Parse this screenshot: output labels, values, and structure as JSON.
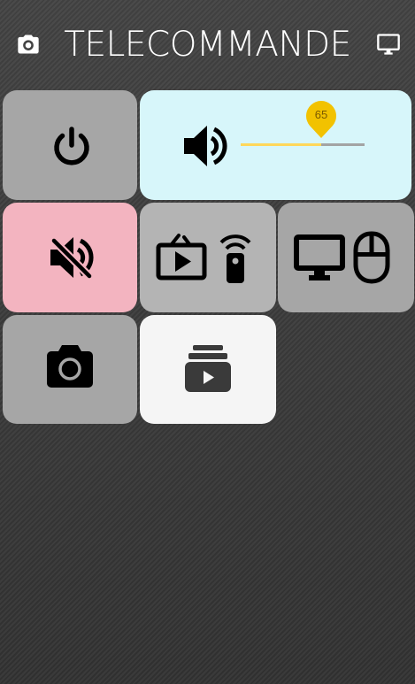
{
  "header": {
    "title": "TELECOMMANDE",
    "left_icon": "camera-icon",
    "right_icon": "monitor-icon"
  },
  "tiles": [
    {
      "name": "power",
      "icon": "power-icon",
      "color": "#a6a6a6"
    },
    {
      "name": "volume",
      "icon": "volume-icon",
      "color": "#d7f6fa"
    },
    {
      "name": "mute",
      "icon": "mute-icon",
      "color": "#f3b4c0"
    },
    {
      "name": "tv-remote",
      "icon": "tv-play-icon",
      "color": "#b4b4b4"
    },
    {
      "name": "pc-mouse",
      "icon": "monitor-mouse-icon",
      "color": "#a6a6a6"
    },
    {
      "name": "screenshot",
      "icon": "camera-icon",
      "color": "#a6a6a6"
    },
    {
      "name": "playlist",
      "icon": "video-stack-icon",
      "color": "#f5f5f5"
    }
  ],
  "volume": {
    "value": 65,
    "label": "65",
    "fill_color": "#ffd75a",
    "pin_color": "#f2c200"
  }
}
